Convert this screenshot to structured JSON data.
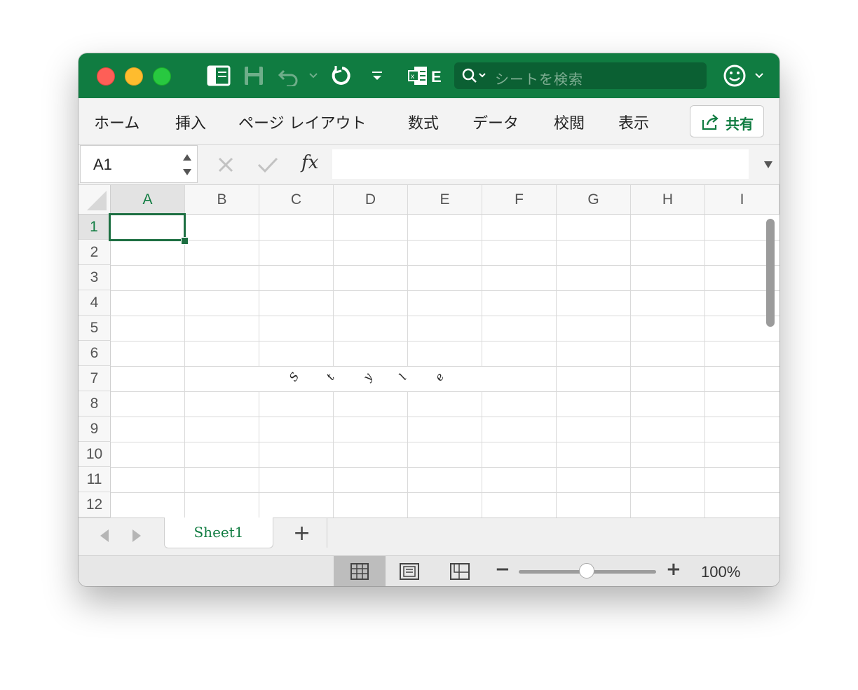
{
  "titlebar": {
    "search_placeholder": "シートを検索",
    "colors": {
      "brand": "#107c41",
      "search_bg": "#0b6033"
    },
    "icons": [
      "sidebar-toggle-icon",
      "save-icon",
      "undo-icon",
      "undo-dropdown-icon",
      "redo-icon",
      "customize-toolbar-icon",
      "excel-file-icon",
      "search-icon",
      "smiley-feedback-icon",
      "feedback-dropdown-icon"
    ]
  },
  "ribbon": {
    "tabs": [
      "ホーム",
      "挿入",
      "ページ レイアウト",
      "数式",
      "データ",
      "校閲",
      "表示"
    ],
    "share_label": "共有"
  },
  "formula_bar": {
    "name_box": "A1",
    "fx_label": "fx",
    "formula": ""
  },
  "grid": {
    "columns": [
      "A",
      "B",
      "C",
      "D",
      "E",
      "F",
      "G",
      "H",
      "I"
    ],
    "rows": [
      "1",
      "2",
      "3",
      "4",
      "5",
      "6",
      "7",
      "8",
      "9",
      "10",
      "11",
      "12"
    ],
    "selected_cell": "A1",
    "merged_text_row7": [
      "S",
      "t",
      "y",
      "l",
      "e"
    ]
  },
  "sheets": {
    "tabs": [
      "Sheet1"
    ],
    "add_label": "+"
  },
  "status": {
    "zoom_label": "100%",
    "zoom_level": 1.0,
    "minus_label": "−",
    "plus_label": "+"
  }
}
